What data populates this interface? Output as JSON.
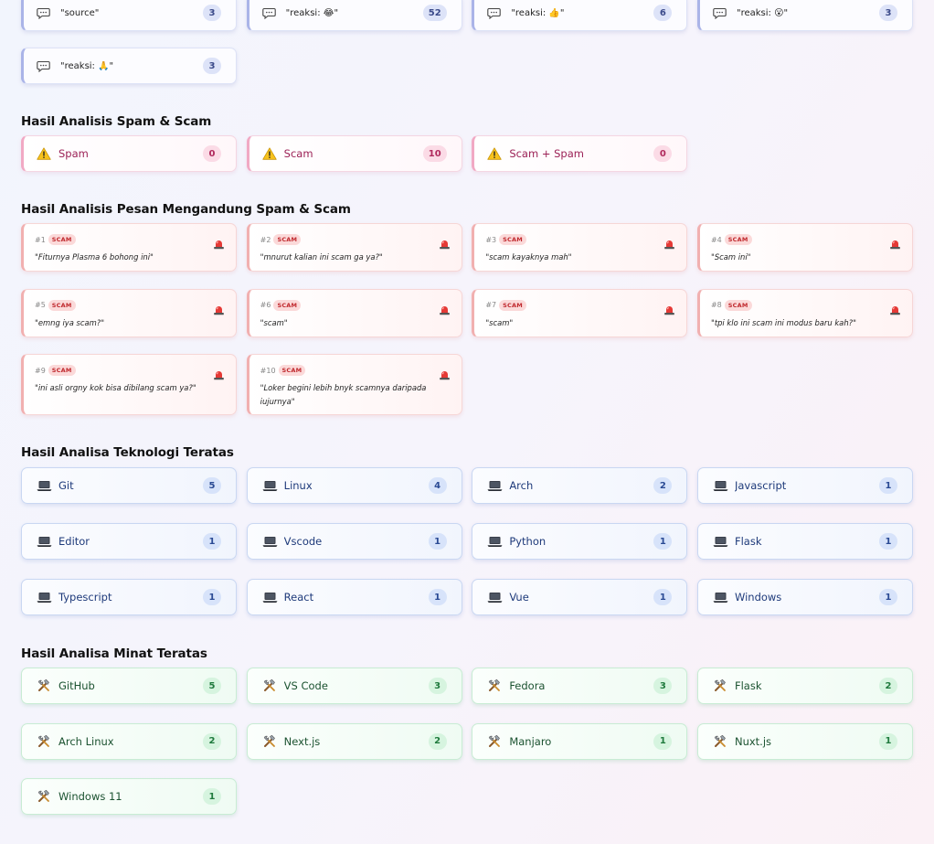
{
  "reactions": [
    {
      "icon": "speech-bubble-icon",
      "label": "\"source\"",
      "count": "3"
    },
    {
      "icon": "speech-bubble-icon",
      "label": "\"reaksi: 😂\"",
      "count": "52"
    },
    {
      "icon": "speech-bubble-icon",
      "label": "\"reaksi: 👍\"",
      "count": "6"
    },
    {
      "icon": "speech-bubble-icon",
      "label": "\"reaksi: 😮\"",
      "count": "3"
    },
    {
      "icon": "speech-bubble-icon",
      "label": "\"reaksi: 🙏\"",
      "count": "3"
    }
  ],
  "spam_section": {
    "title": "Hasil Analisis Spam & Scam",
    "items": [
      {
        "icon": "warning-icon",
        "label": "Spam",
        "count": "0"
      },
      {
        "icon": "warning-icon",
        "label": "Scam",
        "count": "10"
      },
      {
        "icon": "warning-icon",
        "label": "Scam + Spam",
        "count": "0"
      }
    ]
  },
  "messages_section": {
    "title": "Hasil Analisis Pesan Mengandung Spam & Scam",
    "items": [
      {
        "num": "#1",
        "tag": "SCAM",
        "text": "\"Fiturnya Plasma 6 bohong ini\""
      },
      {
        "num": "#2",
        "tag": "SCAM",
        "text": "\"mnurut kalian ini scam ga ya?\""
      },
      {
        "num": "#3",
        "tag": "SCAM",
        "text": "\"scam kayaknya mah\""
      },
      {
        "num": "#4",
        "tag": "SCAM",
        "text": "\"Scam ini\""
      },
      {
        "num": "#5",
        "tag": "SCAM",
        "text": "\"emng iya scam?\""
      },
      {
        "num": "#6",
        "tag": "SCAM",
        "text": "\"scam\""
      },
      {
        "num": "#7",
        "tag": "SCAM",
        "text": "\"scam\""
      },
      {
        "num": "#8",
        "tag": "SCAM",
        "text": "\"tpi klo ini scam ini modus baru kah?\""
      },
      {
        "num": "#9",
        "tag": "SCAM",
        "text": "\"ini asli orgny kok bisa dibilang scam ya?\""
      },
      {
        "num": "#10",
        "tag": "SCAM",
        "text": "\"Loker begini lebih bnyk scamnya daripada iujurnya\""
      }
    ]
  },
  "tech_section": {
    "title": "Hasil Analisa Teknologi Teratas",
    "items": [
      {
        "icon": "laptop-icon",
        "label": "Git",
        "count": "5"
      },
      {
        "icon": "laptop-icon",
        "label": "Linux",
        "count": "4"
      },
      {
        "icon": "laptop-icon",
        "label": "Arch",
        "count": "2"
      },
      {
        "icon": "laptop-icon",
        "label": "Javascript",
        "count": "1"
      },
      {
        "icon": "laptop-icon",
        "label": "Editor",
        "count": "1"
      },
      {
        "icon": "laptop-icon",
        "label": "Vscode",
        "count": "1"
      },
      {
        "icon": "laptop-icon",
        "label": "Python",
        "count": "1"
      },
      {
        "icon": "laptop-icon",
        "label": "Flask",
        "count": "1"
      },
      {
        "icon": "laptop-icon",
        "label": "Typescript",
        "count": "1"
      },
      {
        "icon": "laptop-icon",
        "label": "React",
        "count": "1"
      },
      {
        "icon": "laptop-icon",
        "label": "Vue",
        "count": "1"
      },
      {
        "icon": "laptop-icon",
        "label": "Windows",
        "count": "1"
      }
    ]
  },
  "interest_section": {
    "title": "Hasil Analisa Minat Teratas",
    "items": [
      {
        "icon": "tools-icon",
        "label": "GitHub",
        "count": "5"
      },
      {
        "icon": "tools-icon",
        "label": "VS Code",
        "count": "3"
      },
      {
        "icon": "tools-icon",
        "label": "Fedora",
        "count": "3"
      },
      {
        "icon": "tools-icon",
        "label": "Flask",
        "count": "2"
      },
      {
        "icon": "tools-icon",
        "label": "Arch Linux",
        "count": "2"
      },
      {
        "icon": "tools-icon",
        "label": "Next.js",
        "count": "2"
      },
      {
        "icon": "tools-icon",
        "label": "Manjaro",
        "count": "1"
      },
      {
        "icon": "tools-icon",
        "label": "Nuxt.js",
        "count": "1"
      },
      {
        "icon": "tools-icon",
        "label": "Windows 11",
        "count": "1"
      }
    ]
  }
}
